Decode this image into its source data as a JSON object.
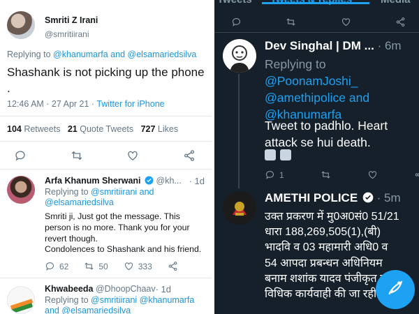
{
  "left": {
    "main_tweet": {
      "name": "Smriti Z Irani",
      "handle": "@smritiirani",
      "replying_prefix": "Replying to ",
      "replying_to": "@khanumarfa and @elsamariedsilva",
      "text": "Shashank is not picking up the phone .",
      "time": "12:46 AM · 27 Apr 21 · ",
      "source": "Twitter for iPhone",
      "retweets_count": "104",
      "retweets_label": " Retweets   ",
      "quote_count": "21",
      "quote_label": " Quote Tweets   ",
      "likes_count": "727",
      "likes_label": " Likes"
    },
    "reply1": {
      "name": "Arfa Khanum Sherwani",
      "handle": "@kh...",
      "time": "· 1d",
      "replying_prefix": "Replying to ",
      "replying_to": "@smritiirani and @elsamariedsilva",
      "text": "Smriti ji, Just got the message. This person is no more. Thank you for your revert though.",
      "text2": "Condolences to Shashank and his friend.",
      "retweets": "50",
      "likes": "333",
      "replies": "62"
    },
    "reply2": {
      "name": "Khwabeeda",
      "handle": "@DhoopChaav",
      "time": "· 1d",
      "replying_prefix": "Replying to ",
      "replying_to": "@smritiirani @khanumarfa and @elsamariedsilva"
    }
  },
  "right": {
    "tabs": [
      "Tweets",
      "Tweets & replies",
      "Media"
    ],
    "tweet1": {
      "name": "Dev Singhal | DM ...",
      "time": "· 6m",
      "replying_prefix": "Replying to ",
      "replying_to": "@PoonamJoshi_ @amethipolice and @khanumarfa",
      "text": "Tweet to padhlo. Heart attack se hui death.",
      "reply_count": "1"
    },
    "tweet2": {
      "name": "AMETHI POLICE",
      "time": "· 5m",
      "lines": [
        "उक्त प्रकरण में मु0अ0सं0 51/21",
        "धारा 188,269,505(1),(बी)",
        "भादवि व 03 महामारी अधि0 व",
        "54 आपदा प्रबन्धन अधिनियम",
        "बनाम शशांक यादव पंजीकृत कर",
        "विधिक कार्यवाही की जा रही"
      ]
    }
  },
  "colors": {
    "accent": "#1da1f2",
    "dark_bg": "#15202b",
    "muted": "#657786"
  },
  "icons": [
    "reply-icon",
    "retweet-icon",
    "like-icon",
    "share-icon",
    "verified-icon",
    "compose-icon"
  ]
}
